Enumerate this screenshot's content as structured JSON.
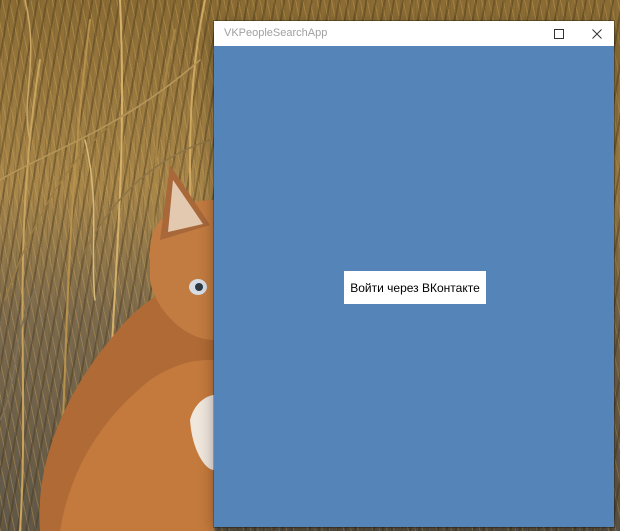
{
  "window": {
    "title": "VKPeopleSearchApp",
    "maximize_icon": "maximize-icon",
    "close_icon": "close-icon"
  },
  "main": {
    "login_button_label": "Войти через ВКонтакте"
  },
  "colors": {
    "client_background": "#5585b8",
    "titlebar_background": "#ffffff",
    "title_text": "#a0a0a0",
    "button_background": "#ffffff"
  }
}
